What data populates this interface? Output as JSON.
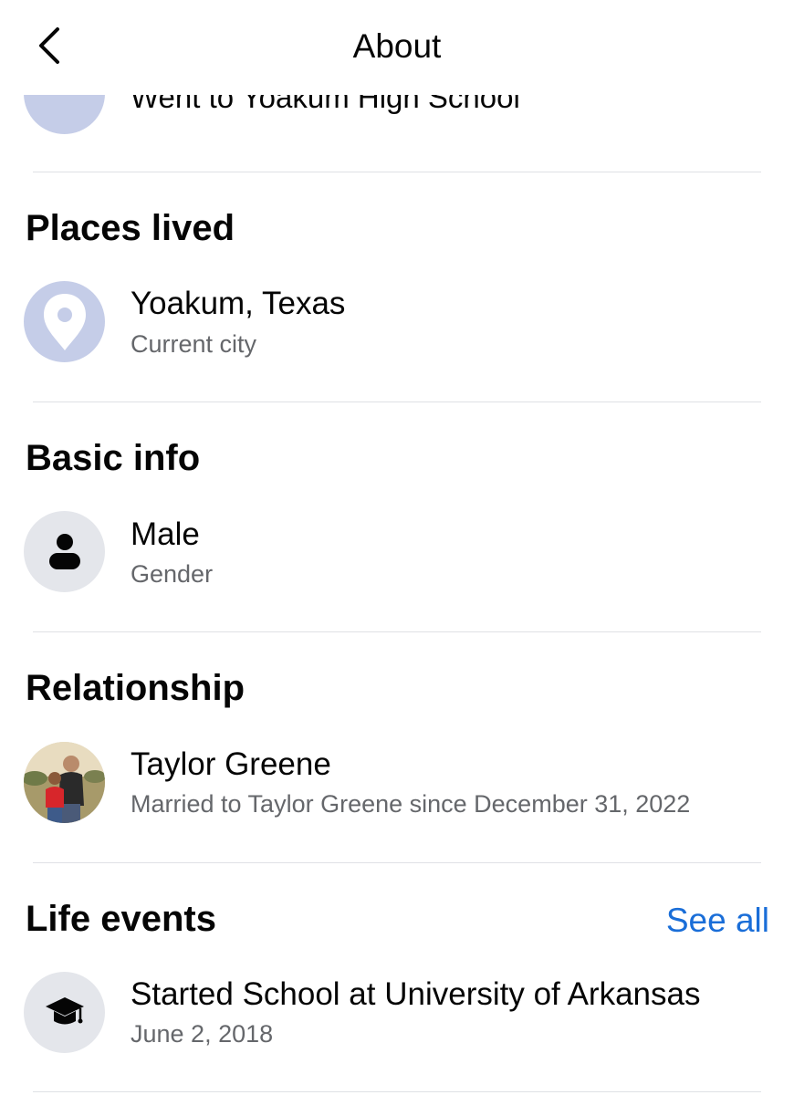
{
  "header": {
    "title": "About",
    "back_icon": "chevron-left-icon"
  },
  "education": {
    "partial_text": "Went to Yoakum High School"
  },
  "places_lived": {
    "title": "Places lived",
    "primary": "Yoakum, Texas",
    "secondary": "Current city",
    "icon": "location-pin-icon"
  },
  "basic_info": {
    "title": "Basic info",
    "primary": "Male",
    "secondary": "Gender",
    "icon": "person-icon"
  },
  "relationship": {
    "title": "Relationship",
    "primary": "Taylor Greene",
    "secondary": "Married to Taylor Greene since December 31, 2022",
    "icon": "couple-photo-avatar"
  },
  "life_events": {
    "title": "Life events",
    "see_all": "See all",
    "primary": "Started School at University of Arkansas",
    "secondary": "June 2, 2018",
    "icon": "graduation-cap-icon"
  },
  "colors": {
    "link": "#1a6ed8",
    "secondary_text": "#65676b",
    "icon_blue_bg": "#c5cde8",
    "icon_gray_bg": "#e4e6eb"
  }
}
